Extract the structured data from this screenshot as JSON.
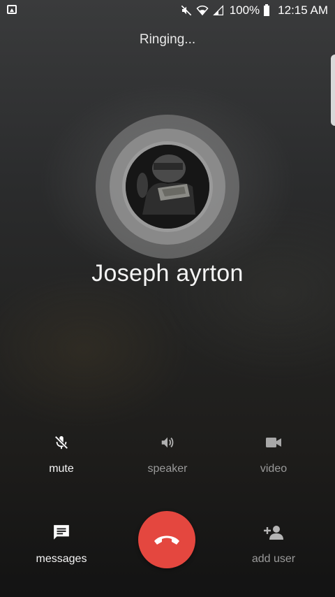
{
  "status_bar": {
    "battery": "100%",
    "time": "12:15 AM",
    "icons": [
      "image-notification-icon",
      "mute-icon",
      "wifi-icon",
      "signal-icon",
      "battery-icon"
    ]
  },
  "call": {
    "status": "Ringing...",
    "contact_name": "Joseph ayrton"
  },
  "actions": {
    "mute": {
      "label": "mute",
      "icon": "mic-off-icon"
    },
    "speaker": {
      "label": "speaker",
      "icon": "speaker-icon"
    },
    "video": {
      "label": "video",
      "icon": "video-camera-icon"
    },
    "messages": {
      "label": "messages",
      "icon": "message-icon"
    },
    "end_call": {
      "icon": "hang-up-icon",
      "color": "#e4473f"
    },
    "add_user": {
      "label": "add user",
      "icon": "add-person-icon"
    }
  }
}
